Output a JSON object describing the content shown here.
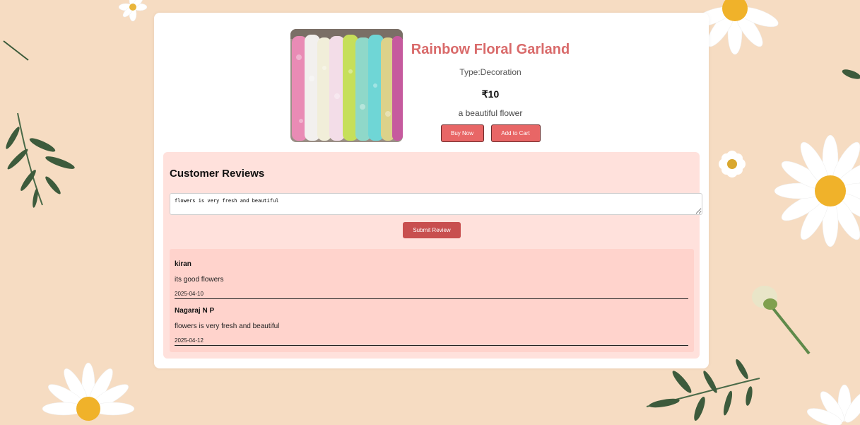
{
  "product": {
    "title": "Rainbow Floral Garland",
    "type": "Type:Decoration",
    "price": "₹10",
    "description": "a beautiful flower",
    "buy_label": "Buy Now",
    "cart_label": "Add to Cart"
  },
  "reviews": {
    "heading": "Customer Reviews",
    "input_value": "flowers is very fresh and beautiful",
    "submit_label": "Submit Review",
    "items": [
      {
        "name": "kiran",
        "comment": "its good flowers",
        "date": "2025-04-10"
      },
      {
        "name": "Nagaraj N P",
        "comment": "flowers is very fresh and beautiful",
        "date": "2025-04-12"
      }
    ]
  },
  "colors": {
    "background": "#f6dcc2",
    "accent": "#e86666",
    "title": "#d96a6a",
    "reviews_panel": "#ffe1dc",
    "review_list": "#ffd3cc"
  }
}
